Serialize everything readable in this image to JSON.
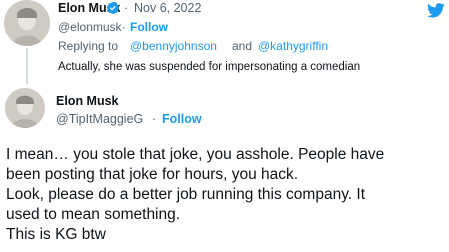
{
  "reply_tweet": {
    "display_name": "Elon Musk",
    "separator": "·",
    "date": "Nov 6, 2022",
    "handle": "@elonmusk",
    "follow_sep": "·",
    "follow_label": "Follow",
    "replying_prefix": "Replying to",
    "mention_1": "@bennyjohnson",
    "and_word": "and",
    "mention_2": "@kathygriffin",
    "text": "Actually, she was suspended for impersonating a comedian"
  },
  "quoted_tweet": {
    "display_name": "Elon Musk",
    "handle": "@TipItMaggieG",
    "follow_sep": "·",
    "follow_label": "Follow",
    "lines": [
      "I mean… you stole that joke, you asshole. People have",
      "been posting that joke for hours, you hack.",
      "Look, please do a better job running this company. It",
      "used to mean something.",
      "This is KG btw"
    ]
  },
  "colors": {
    "accent": "#1d9bf0",
    "text": "#0f1419",
    "secondary": "#536471"
  },
  "icons": {
    "verified": "verified-badge-icon",
    "brand": "twitter-bird-icon"
  }
}
